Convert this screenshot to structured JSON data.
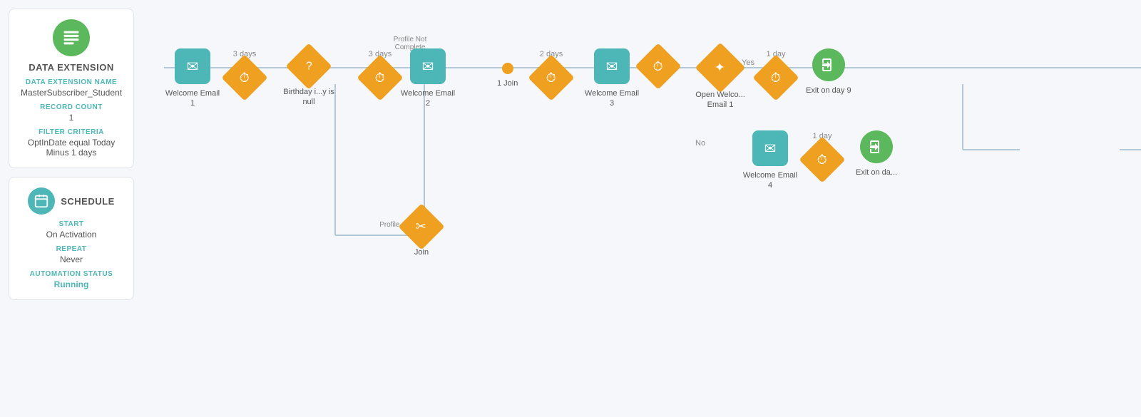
{
  "leftPanel": {
    "dataExtension": {
      "title": "DATA EXTENSION",
      "nameLabel": "DATA EXTENSION NAME",
      "nameValue": "MasterSubscriber_Student",
      "recordCountLabel": "RECORD COUNT",
      "recordCountValue": "1",
      "filterLabel": "FILTER CRITERIA",
      "filterValue": "OptInDate equal Today Minus 1 days"
    },
    "schedule": {
      "title": "Schedule",
      "startLabel": "START",
      "startValue": "On Activation",
      "repeatLabel": "REPEAT",
      "repeatValue": "Never",
      "statusLabel": "AUTOMATION STATUS",
      "statusValue": "Running"
    }
  },
  "flow": {
    "nodes": [
      {
        "id": "email1",
        "type": "email",
        "label": "Welcome Email 1"
      },
      {
        "id": "wait1",
        "type": "wait",
        "days": "3 days"
      },
      {
        "id": "decision1",
        "type": "decision",
        "label": "Birthday i...y is null"
      },
      {
        "id": "email2",
        "type": "email",
        "label": "Welcome Email 2",
        "branchLabel": "Profile Not Complete"
      },
      {
        "id": "wait2",
        "type": "wait",
        "days": "3 days"
      },
      {
        "id": "joindot",
        "type": "joindot",
        "label": "1 Join"
      },
      {
        "id": "email3",
        "type": "email",
        "label": "Welcome Email 3"
      },
      {
        "id": "wait3",
        "type": "wait",
        "days": "2 days"
      },
      {
        "id": "opencheck",
        "type": "decision-star",
        "label": "Open Welco... Email 1"
      },
      {
        "id": "wait4",
        "type": "wait",
        "days": "1 day"
      },
      {
        "id": "exit1",
        "type": "exit",
        "label": "Exit on day 9"
      },
      {
        "id": "join1",
        "type": "join",
        "label": "Join",
        "branchLabel": "Profile Complete"
      },
      {
        "id": "email4",
        "type": "email",
        "label": "Welcome Email 4"
      },
      {
        "id": "wait5",
        "type": "wait",
        "days": "1 day"
      },
      {
        "id": "exit2",
        "type": "exit",
        "label": "Exit on da..."
      }
    ],
    "yesLabel": "Yes",
    "noLabel": "No"
  }
}
